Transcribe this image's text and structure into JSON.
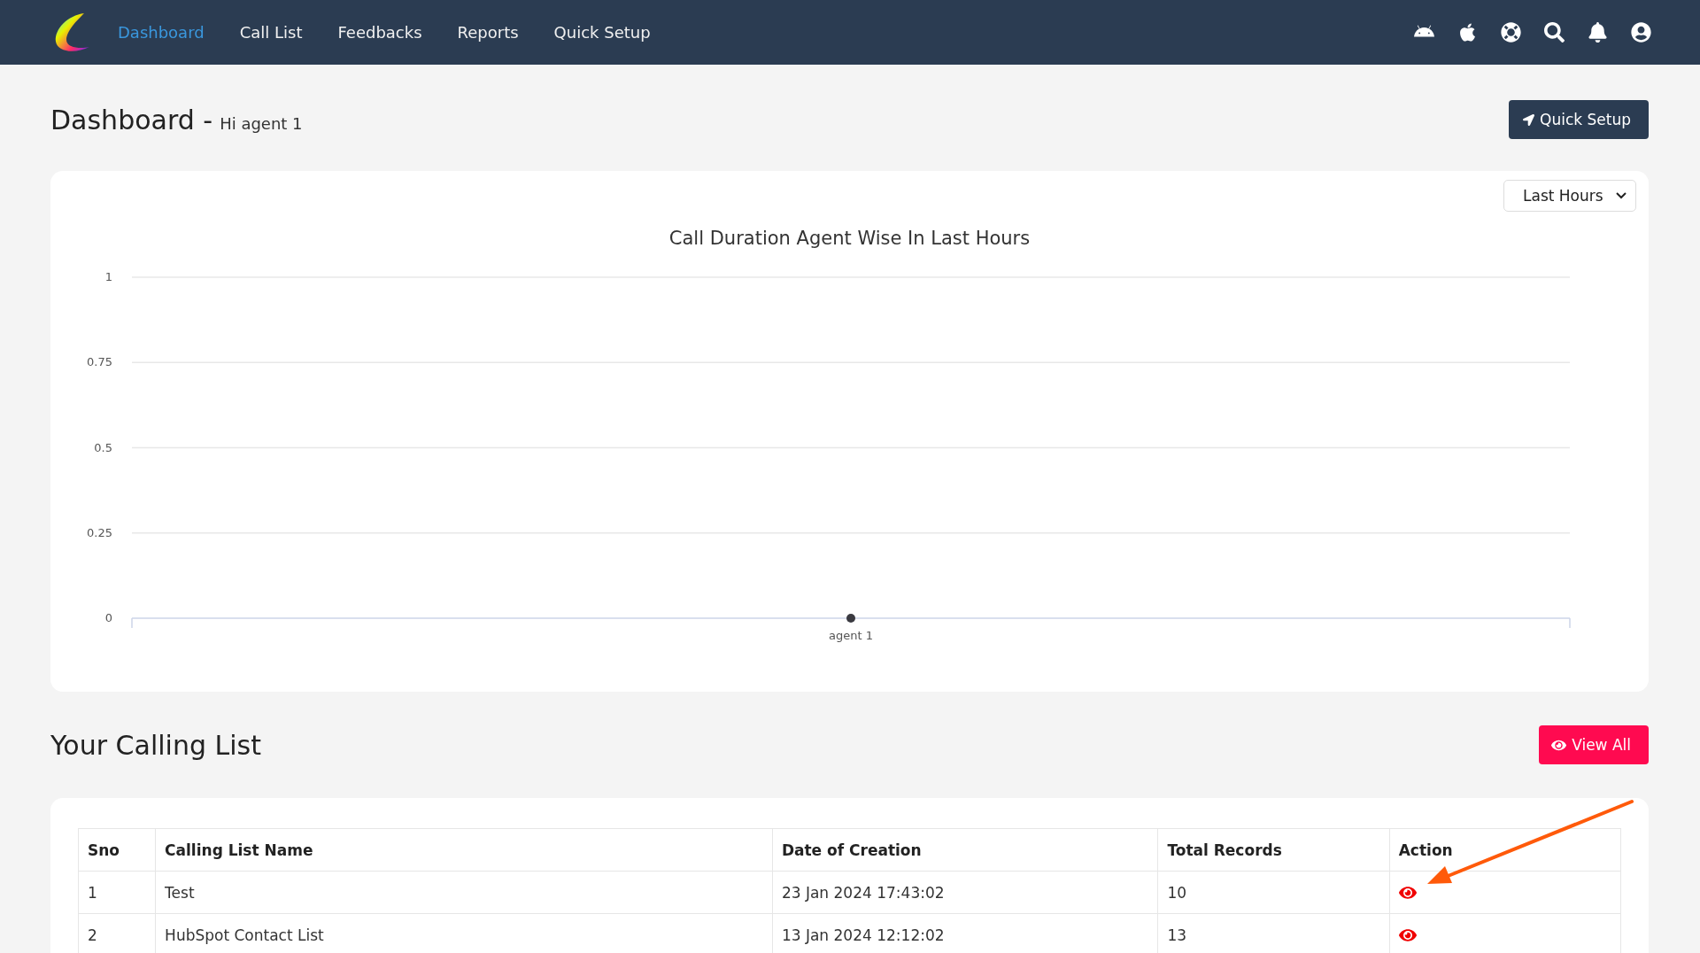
{
  "nav": {
    "items": [
      {
        "label": "Dashboard",
        "selected": true
      },
      {
        "label": "Call List",
        "selected": false
      },
      {
        "label": "Feedbacks",
        "selected": false
      },
      {
        "label": "Reports",
        "selected": false
      },
      {
        "label": "Quick Setup",
        "selected": false
      }
    ]
  },
  "header": {
    "title": "Dashboard -",
    "greeting": "Hi agent 1",
    "button": "Quick Setup"
  },
  "chart_card": {
    "period_select": {
      "value": "Last Hours"
    },
    "chart_data": {
      "type": "line",
      "title": "Call Duration Agent Wise In Last Hours",
      "categories": [
        "agent 1"
      ],
      "series": [
        {
          "color": "#3a3a40",
          "marker": true,
          "values": [
            0
          ]
        }
      ],
      "grid": true,
      "ylim": [
        0,
        1
      ],
      "yticks": [
        0,
        0.25,
        0.5,
        0.75,
        1
      ]
    }
  },
  "calling_list": {
    "title": "Your Calling List",
    "button": "View All",
    "table": {
      "columns": [
        "Sno",
        "Calling List Name",
        "Date of Creation",
        "Total Records",
        "Action"
      ],
      "rows": [
        {
          "cells": [
            "1",
            "Test",
            "23 Jan 2024 17:43:02",
            "10"
          ]
        },
        {
          "cells": [
            "2",
            "HubSpot Contact List",
            "13 Jan 2024 12:12:02",
            "13"
          ]
        }
      ]
    }
  }
}
